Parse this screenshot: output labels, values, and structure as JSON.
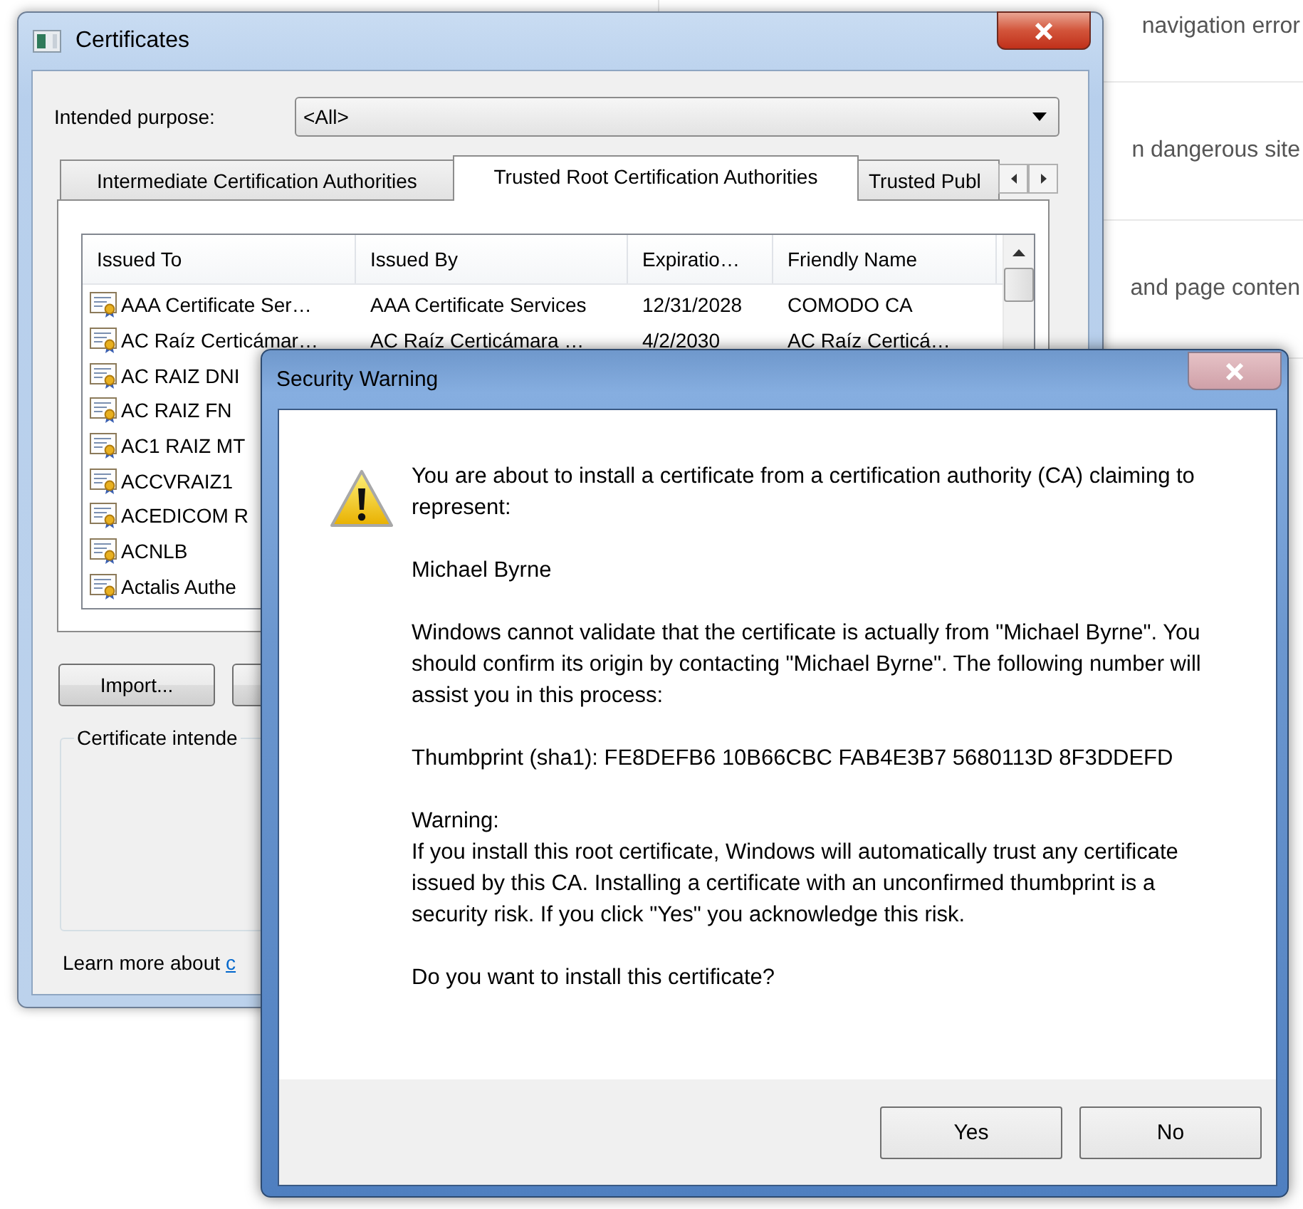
{
  "background_page": {
    "items": [
      {
        "label": "navigation error"
      },
      {
        "label": "n dangerous site"
      },
      {
        "label": "and page conten"
      }
    ]
  },
  "certificates_window": {
    "title": "Certificates",
    "intended_purpose": {
      "label": "Intended purpose:",
      "value": "<All>"
    },
    "tabs": [
      {
        "label": "Intermediate Certification Authorities",
        "selected": false
      },
      {
        "label": "Trusted Root Certification Authorities",
        "selected": true
      },
      {
        "label": "Trusted Publ",
        "selected": false
      }
    ],
    "table": {
      "columns": [
        "Issued To",
        "Issued By",
        "Expiratio…",
        "Friendly Name"
      ],
      "rows": [
        [
          "AAA Certificate Ser…",
          "AAA Certificate Services",
          "12/31/2028",
          "COMODO CA"
        ],
        [
          "AC Raíz Certicámar…",
          "AC Raíz Certicámara …",
          "4/2/2030",
          "AC Raíz Certicá…"
        ],
        [
          "AC RAIZ DNI"
        ],
        [
          "AC RAIZ FN"
        ],
        [
          "AC1 RAIZ MT"
        ],
        [
          "ACCVRAIZ1"
        ],
        [
          "ACEDICOM R"
        ],
        [
          "ACNLB"
        ],
        [
          "Actalis Authe"
        ]
      ]
    },
    "import_button": "Import...",
    "group_label": "Certificate intende",
    "learn_more": {
      "text": "Learn more about",
      "link": "c"
    }
  },
  "security_warning": {
    "title": "Security Warning",
    "paragraphs": [
      "You are about to install a certificate from a certification authority (CA) claiming to represent:",
      "Michael Byrne",
      "Windows cannot validate that the certificate is actually from \"Michael Byrne\". You should confirm its origin by contacting \"Michael Byrne\". The following number will assist you in this process:",
      "Thumbprint (sha1): FE8DEFB6 10B66CBC FAB4E3B7 5680113D 8F3DDEFD",
      "Warning:\nIf you install this root certificate, Windows will automatically trust any certificate issued by this CA. Installing a certificate with an unconfirmed thumbprint is a security risk. If you click \"Yes\" you acknowledge this risk.",
      "Do you want to install this certificate?"
    ],
    "buttons": [
      "Yes",
      "No"
    ]
  }
}
